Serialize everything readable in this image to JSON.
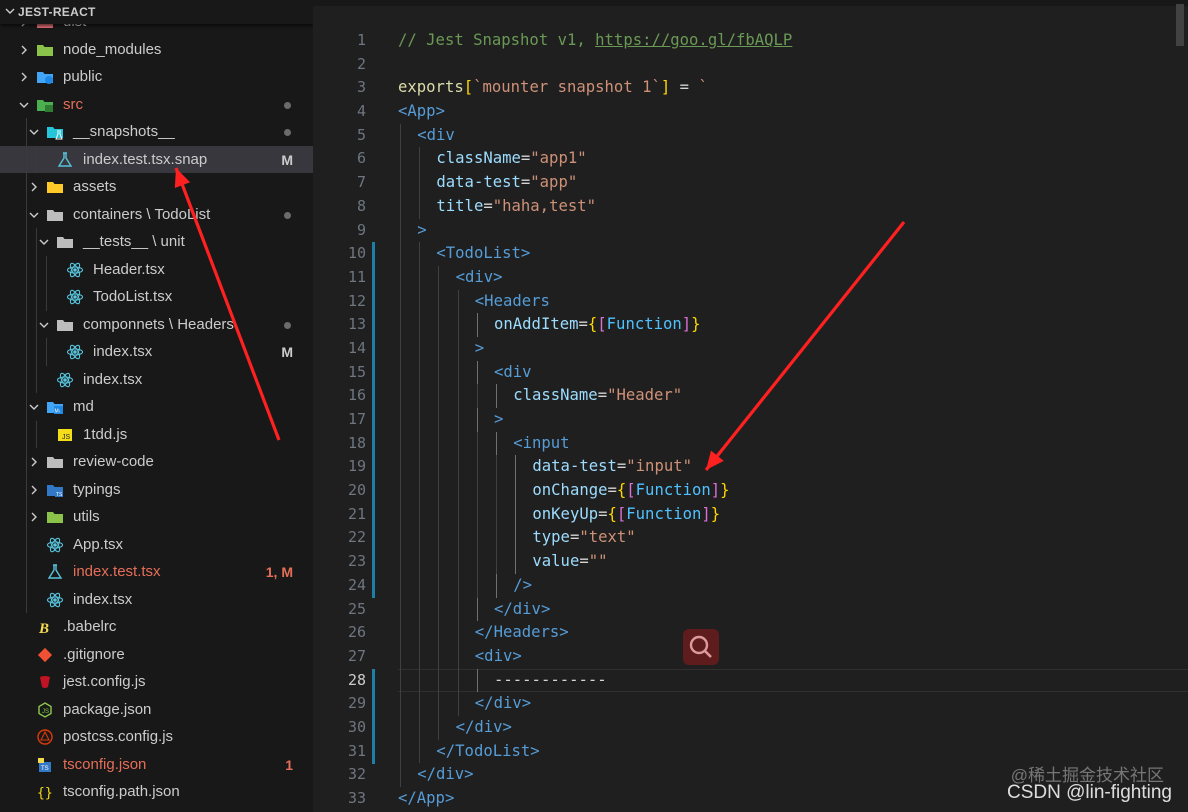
{
  "explorer": {
    "title": "JEST-REACT",
    "items": [
      {
        "label": "dist",
        "indent": 1,
        "kind": "folder",
        "icon": "dist-folder-icon",
        "collapsed": true,
        "color": "#cccccc"
      },
      {
        "label": "node_modules",
        "indent": 1,
        "kind": "folder",
        "icon": "node-modules-folder-icon",
        "collapsed": true,
        "color": "#cccccc"
      },
      {
        "label": "public",
        "indent": 1,
        "kind": "folder",
        "icon": "public-folder-icon",
        "collapsed": true,
        "color": "#cccccc"
      },
      {
        "label": "src",
        "indent": 1,
        "kind": "folder",
        "icon": "src-folder-icon",
        "collapsed": false,
        "color": "#e66e59",
        "dot": true
      },
      {
        "label": "__snapshots__",
        "indent": 2,
        "kind": "folder",
        "icon": "snapshots-folder-icon",
        "collapsed": false,
        "color": "#cccccc",
        "dot": true
      },
      {
        "label": "index.test.tsx.snap",
        "indent": 3,
        "kind": "file",
        "icon": "jest-snapshot-icon",
        "color": "#cccccc",
        "badge": "M",
        "badge_color": "#cccccc",
        "selected": true
      },
      {
        "label": "assets",
        "indent": 2,
        "kind": "folder",
        "icon": "assets-folder-icon",
        "collapsed": true,
        "color": "#cccccc"
      },
      {
        "label": "containers \\ TodoList",
        "indent": 2,
        "kind": "folder",
        "icon": "containers-folder-icon",
        "collapsed": false,
        "color": "#cccccc",
        "dot": true
      },
      {
        "label": "__tests__ \\ unit",
        "indent": 3,
        "kind": "folder",
        "icon": "tests-folder-icon",
        "collapsed": false,
        "color": "#cccccc"
      },
      {
        "label": "Header.tsx",
        "indent": 4,
        "kind": "file",
        "icon": "react-icon",
        "color": "#cccccc"
      },
      {
        "label": "TodoList.tsx",
        "indent": 4,
        "kind": "file",
        "icon": "react-icon",
        "color": "#cccccc"
      },
      {
        "label": "componnets \\ Headers",
        "indent": 3,
        "kind": "folder",
        "icon": "components-folder-icon",
        "collapsed": false,
        "color": "#cccccc",
        "dot": true
      },
      {
        "label": "index.tsx",
        "indent": 4,
        "kind": "file",
        "icon": "react-icon",
        "color": "#cccccc",
        "badge": "M",
        "badge_color": "#cccccc"
      },
      {
        "label": "index.tsx",
        "indent": 3,
        "kind": "file",
        "icon": "react-icon",
        "color": "#cccccc"
      },
      {
        "label": "md",
        "indent": 2,
        "kind": "folder",
        "icon": "markdown-folder-icon",
        "collapsed": false,
        "color": "#cccccc"
      },
      {
        "label": "1tdd.js",
        "indent": 3,
        "kind": "file",
        "icon": "javascript-icon",
        "color": "#cccccc"
      },
      {
        "label": "review-code",
        "indent": 2,
        "kind": "folder",
        "icon": "folder-icon",
        "collapsed": true,
        "color": "#cccccc"
      },
      {
        "label": "typings",
        "indent": 2,
        "kind": "folder",
        "icon": "typescript-folder-icon",
        "collapsed": true,
        "color": "#cccccc"
      },
      {
        "label": "utils",
        "indent": 2,
        "kind": "folder",
        "icon": "utils-folder-icon",
        "collapsed": true,
        "color": "#cccccc"
      },
      {
        "label": "App.tsx",
        "indent": 2,
        "kind": "file",
        "icon": "react-icon",
        "color": "#cccccc"
      },
      {
        "label": "index.test.tsx",
        "indent": 2,
        "kind": "file",
        "icon": "jest-test-icon",
        "color": "#e66e59",
        "badge": "1, M",
        "badge_color": "#e66e59"
      },
      {
        "label": "index.tsx",
        "indent": 2,
        "kind": "file",
        "icon": "react-icon",
        "color": "#cccccc"
      },
      {
        "label": ".babelrc",
        "indent": 1,
        "kind": "file",
        "icon": "babel-icon",
        "color": "#cccccc"
      },
      {
        "label": ".gitignore",
        "indent": 1,
        "kind": "file",
        "icon": "git-icon",
        "color": "#cccccc"
      },
      {
        "label": "jest.config.js",
        "indent": 1,
        "kind": "file",
        "icon": "jest-config-icon",
        "color": "#cccccc"
      },
      {
        "label": "package.json",
        "indent": 1,
        "kind": "file",
        "icon": "nodejs-icon",
        "color": "#cccccc"
      },
      {
        "label": "postcss.config.js",
        "indent": 1,
        "kind": "file",
        "icon": "postcss-icon",
        "color": "#cccccc"
      },
      {
        "label": "tsconfig.json",
        "indent": 1,
        "kind": "file",
        "icon": "tsconfig-icon",
        "color": "#e66e59",
        "badge": "1",
        "badge_color": "#e66e59"
      },
      {
        "label": "tsconfig.path.json",
        "indent": 1,
        "kind": "file",
        "icon": "json-icon",
        "color": "#cccccc"
      }
    ]
  },
  "editor": {
    "lines": [
      {
        "n": "1",
        "indent": 0,
        "tokens": [
          [
            "com",
            "// Jest Snapshot v1, "
          ],
          [
            "link",
            "https://goo.gl/fbAQLP"
          ]
        ]
      },
      {
        "n": "2",
        "indent": 0,
        "tokens": []
      },
      {
        "n": "3",
        "indent": 0,
        "tokens": [
          [
            "fn",
            "exports"
          ],
          [
            "br",
            "["
          ],
          [
            "str",
            "`mounter snapshot 1`"
          ],
          [
            "br",
            "]"
          ],
          [
            "op",
            " = "
          ],
          [
            "str",
            "`"
          ]
        ]
      },
      {
        "n": "4",
        "indent": 0,
        "tokens": [
          [
            "tag",
            "<App"
          ],
          [
            "tag",
            ">"
          ]
        ]
      },
      {
        "n": "5",
        "indent": 1,
        "tokens": [
          [
            "tag",
            "<div"
          ]
        ]
      },
      {
        "n": "6",
        "indent": 2,
        "tokens": [
          [
            "attr",
            "className"
          ],
          [
            "op",
            "="
          ],
          [
            "str",
            "\"app1\""
          ]
        ]
      },
      {
        "n": "7",
        "indent": 2,
        "tokens": [
          [
            "attr",
            "data-test"
          ],
          [
            "op",
            "="
          ],
          [
            "str",
            "\"app\""
          ]
        ]
      },
      {
        "n": "8",
        "indent": 2,
        "tokens": [
          [
            "attr",
            "title"
          ],
          [
            "op",
            "="
          ],
          [
            "str",
            "\"haha,test\""
          ]
        ]
      },
      {
        "n": "9",
        "indent": 1,
        "tokens": [
          [
            "tag",
            ">"
          ]
        ]
      },
      {
        "n": "10",
        "indent": 2,
        "tokens": [
          [
            "tag",
            "<TodoList"
          ],
          [
            "tag",
            ">"
          ]
        ]
      },
      {
        "n": "11",
        "indent": 3,
        "tokens": [
          [
            "tag",
            "<div"
          ],
          [
            "tag",
            ">"
          ]
        ]
      },
      {
        "n": "12",
        "indent": 4,
        "tokens": [
          [
            "tag",
            "<Headers"
          ]
        ]
      },
      {
        "n": "13",
        "indent": 5,
        "tokens": [
          [
            "attr",
            "onAddItem"
          ],
          [
            "op",
            "="
          ],
          [
            "br",
            "{"
          ],
          [
            "br2",
            "["
          ],
          [
            "cls",
            "Function"
          ],
          [
            "br2",
            "]"
          ],
          [
            "br",
            "}"
          ]
        ]
      },
      {
        "n": "14",
        "indent": 4,
        "tokens": [
          [
            "tag",
            ">"
          ]
        ]
      },
      {
        "n": "15",
        "indent": 5,
        "tokens": [
          [
            "tag",
            "<div"
          ]
        ]
      },
      {
        "n": "16",
        "indent": 6,
        "tokens": [
          [
            "attr",
            "className"
          ],
          [
            "op",
            "="
          ],
          [
            "str",
            "\"Header\""
          ]
        ]
      },
      {
        "n": "17",
        "indent": 5,
        "tokens": [
          [
            "tag",
            ">"
          ]
        ]
      },
      {
        "n": "18",
        "indent": 6,
        "tokens": [
          [
            "tag",
            "<input"
          ]
        ]
      },
      {
        "n": "19",
        "indent": 7,
        "tokens": [
          [
            "attr",
            "data-test"
          ],
          [
            "op",
            "="
          ],
          [
            "str",
            "\"input\""
          ]
        ]
      },
      {
        "n": "20",
        "indent": 7,
        "tokens": [
          [
            "attr",
            "onChange"
          ],
          [
            "op",
            "="
          ],
          [
            "br",
            "{"
          ],
          [
            "br2",
            "["
          ],
          [
            "cls",
            "Function"
          ],
          [
            "br2",
            "]"
          ],
          [
            "br",
            "}"
          ]
        ]
      },
      {
        "n": "21",
        "indent": 7,
        "tokens": [
          [
            "attr",
            "onKeyUp"
          ],
          [
            "op",
            "="
          ],
          [
            "br",
            "{"
          ],
          [
            "br2",
            "["
          ],
          [
            "cls",
            "Function"
          ],
          [
            "br2",
            "]"
          ],
          [
            "br",
            "}"
          ]
        ]
      },
      {
        "n": "22",
        "indent": 7,
        "tokens": [
          [
            "attr",
            "type"
          ],
          [
            "op",
            "="
          ],
          [
            "str",
            "\"text\""
          ]
        ]
      },
      {
        "n": "23",
        "indent": 7,
        "tokens": [
          [
            "attr",
            "value"
          ],
          [
            "op",
            "="
          ],
          [
            "str",
            "\"\""
          ]
        ]
      },
      {
        "n": "24",
        "indent": 6,
        "tokens": [
          [
            "tag",
            "/>"
          ]
        ]
      },
      {
        "n": "25",
        "indent": 5,
        "tokens": [
          [
            "tag",
            "</div"
          ],
          [
            "tag",
            ">"
          ]
        ]
      },
      {
        "n": "26",
        "indent": 4,
        "tokens": [
          [
            "tag",
            "</Headers"
          ],
          [
            "tag",
            ">"
          ]
        ]
      },
      {
        "n": "27",
        "indent": 4,
        "tokens": [
          [
            "tag",
            "<div"
          ],
          [
            "tag",
            ">"
          ]
        ]
      },
      {
        "n": "28",
        "indent": 5,
        "tokens": [
          [
            "op",
            "------------"
          ]
        ],
        "current": true
      },
      {
        "n": "29",
        "indent": 4,
        "tokens": [
          [
            "tag",
            "</div"
          ],
          [
            "tag",
            ">"
          ]
        ]
      },
      {
        "n": "30",
        "indent": 3,
        "tokens": [
          [
            "tag",
            "</div"
          ],
          [
            "tag",
            ">"
          ]
        ]
      },
      {
        "n": "31",
        "indent": 2,
        "tokens": [
          [
            "tag",
            "</TodoList"
          ],
          [
            "tag",
            ">"
          ]
        ]
      },
      {
        "n": "32",
        "indent": 1,
        "tokens": [
          [
            "tag",
            "</div"
          ],
          [
            "tag",
            ">"
          ]
        ]
      },
      {
        "n": "33",
        "indent": 0,
        "tokens": [
          [
            "tag",
            "</App"
          ],
          [
            "tag",
            ">"
          ]
        ]
      }
    ]
  },
  "watermark": {
    "line1": "@稀土掘金技术社区",
    "line2": "CSDN @lin-fighting"
  },
  "annotation_color": "#ff2020"
}
